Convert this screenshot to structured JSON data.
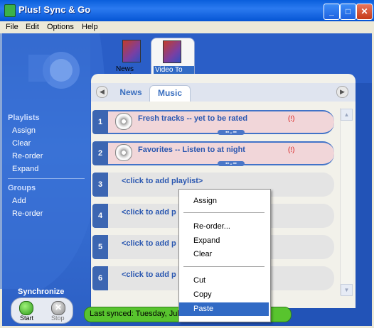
{
  "window": {
    "title": "Plus! Sync & Go"
  },
  "menubar": [
    "File",
    "Edit",
    "Options",
    "Help"
  ],
  "devices": [
    {
      "label": "News Card"
    },
    {
      "label": "Video To Go",
      "active": true
    }
  ],
  "sidebar": {
    "playlists_title": "Playlists",
    "playlists_items": [
      "Assign",
      "Clear",
      "Re-order",
      "Expand"
    ],
    "groups_title": "Groups",
    "groups_items": [
      "Add",
      "Re-order"
    ]
  },
  "subtabs": [
    "News",
    "Music"
  ],
  "active_subtab": "Music",
  "playlists": [
    {
      "num": "1",
      "title": "Fresh tracks -- yet to be rated",
      "warn": "(!)"
    },
    {
      "num": "2",
      "title": "Favorites -- Listen to at night",
      "warn": "(!)"
    },
    {
      "num": "3",
      "title": "<click to add playlist>"
    },
    {
      "num": "4",
      "title": "<click to add p"
    },
    {
      "num": "5",
      "title": "<click to add p"
    },
    {
      "num": "6",
      "title": "<click to add p"
    }
  ],
  "sync": {
    "title": "Synchronize",
    "start": "Start",
    "stop": "Stop"
  },
  "status": {
    "text": "Last synced: Tuesday, Jul"
  },
  "context_menu": {
    "items": [
      "Assign",
      "Re-order...",
      "Expand",
      "Clear",
      "Cut",
      "Copy",
      "Paste"
    ],
    "highlighted": "Paste"
  },
  "colors": {
    "accent": "#2253b7",
    "status_green": "#58c42e",
    "highlight": "#316ac5",
    "warning": "#d81818"
  },
  "icons": [
    "app-icon",
    "minimize-icon",
    "maximize-icon",
    "close-icon",
    "cd-icon",
    "start-icon",
    "stop-icon"
  ]
}
